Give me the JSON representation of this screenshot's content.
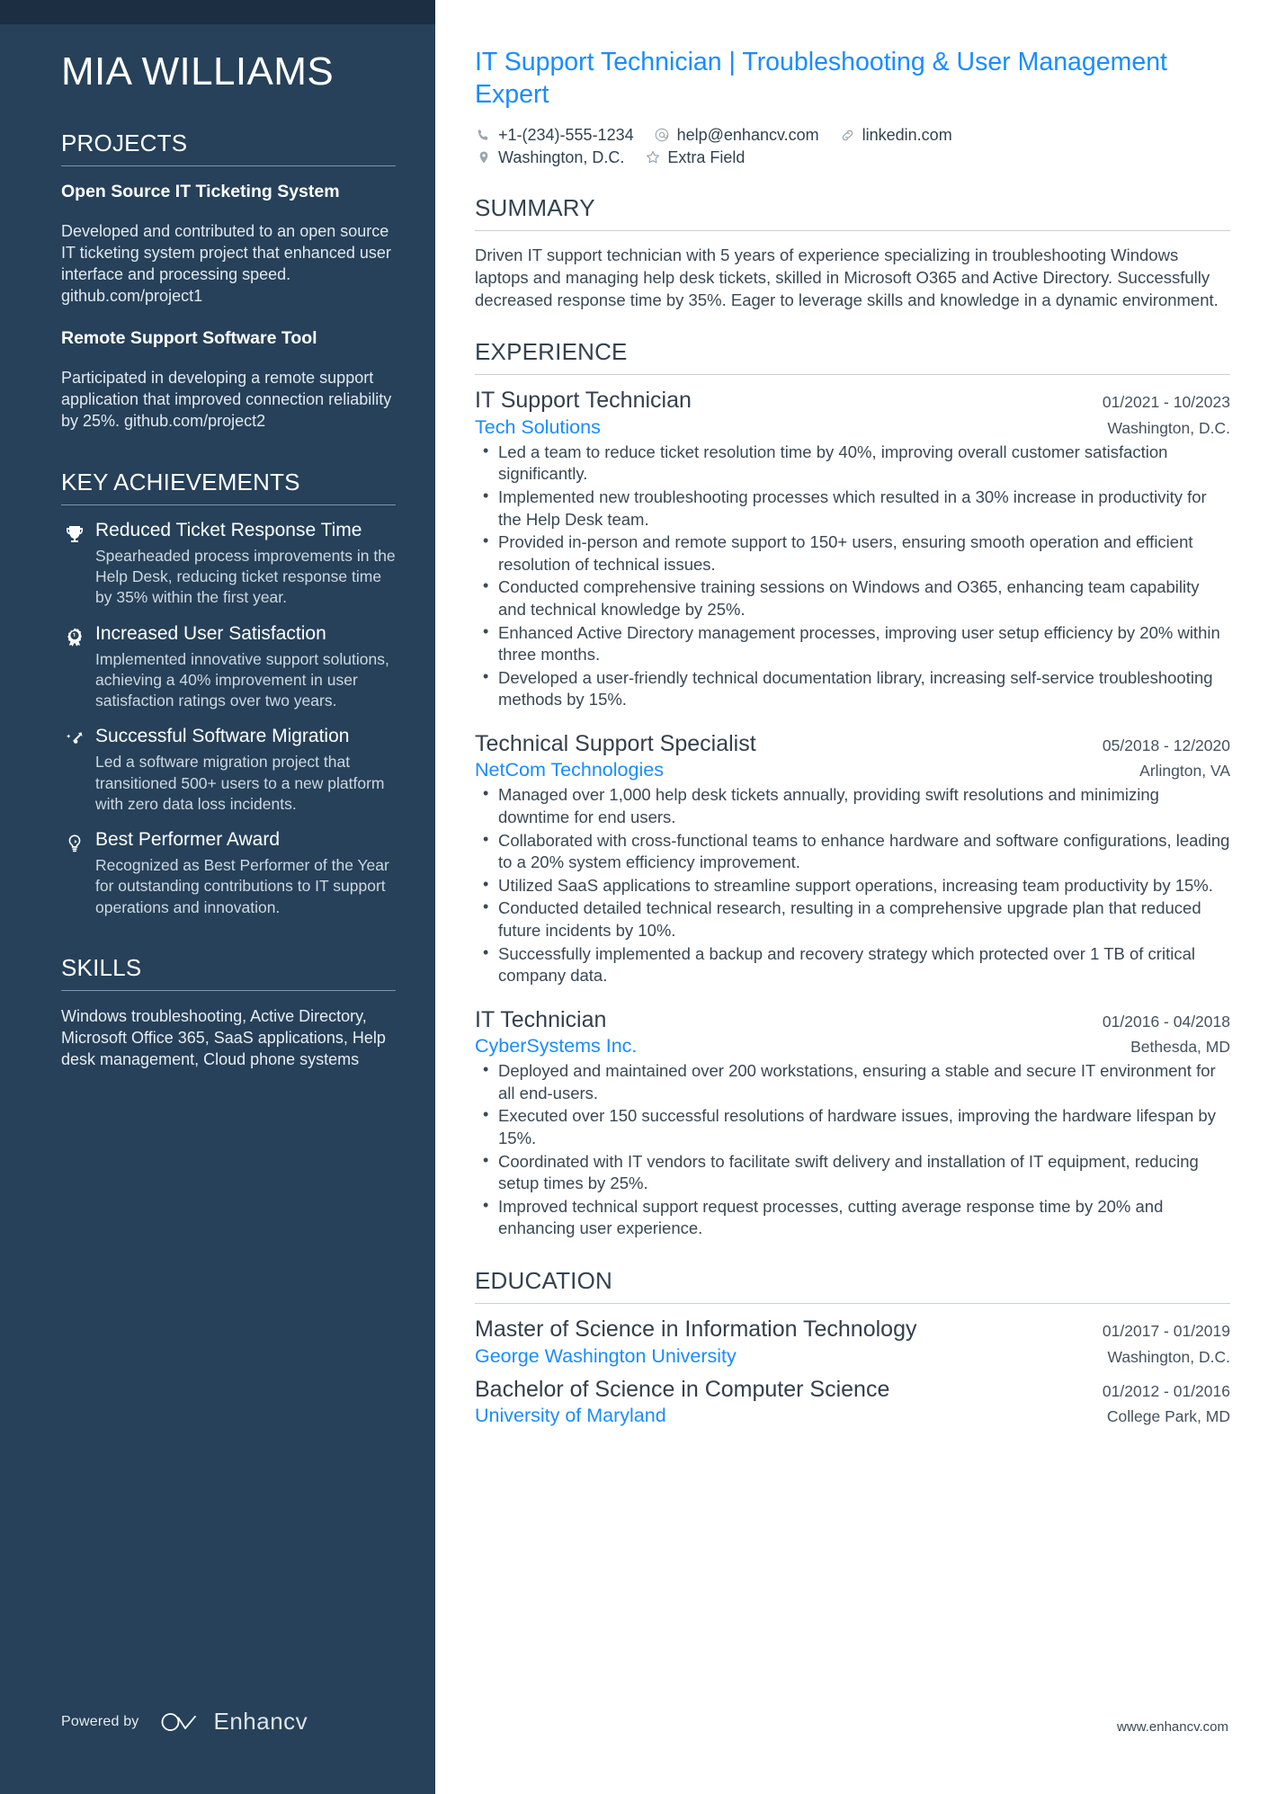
{
  "sidebar": {
    "name": "MIA WILLIAMS",
    "projects": {
      "title": "PROJECTS",
      "items": [
        {
          "name": "Open Source IT Ticketing System",
          "description": "Developed and contributed to an open source IT ticketing system project that enhanced user interface and processing speed. github.com/project1"
        },
        {
          "name": "Remote Support Software Tool",
          "description": "Participated in developing a remote support application that improved connection reliability by 25%. github.com/project2"
        }
      ]
    },
    "achievements": {
      "title": "KEY ACHIEVEMENTS",
      "items": [
        {
          "icon": "trophy-icon",
          "title": "Reduced Ticket Response Time",
          "description": "Spearheaded process improvements in the Help Desk, reducing ticket response time by 35% within the first year."
        },
        {
          "icon": "award-ribbon-icon",
          "title": "Increased User Satisfaction",
          "description": "Implemented innovative support solutions, achieving a 40% improvement in user satisfaction ratings over two years."
        },
        {
          "icon": "growth-arrow-icon",
          "title": "Successful Software Migration",
          "description": "Led a software migration project that transitioned 500+ users to a new platform with zero data loss incidents."
        },
        {
          "icon": "lightbulb-icon",
          "title": "Best Performer Award",
          "description": "Recognized as Best Performer of the Year for outstanding contributions to IT support operations and innovation."
        }
      ]
    },
    "skills": {
      "title": "SKILLS",
      "text": "Windows troubleshooting, Active Directory, Microsoft Office 365, SaaS applications, Help desk management, Cloud phone systems"
    },
    "footer": {
      "powered_by": "Powered by",
      "brand": "Enhancv"
    }
  },
  "main": {
    "headline": "IT Support Technician | Troubleshooting & User Management Expert",
    "contacts_row1": [
      {
        "icon": "phone-icon",
        "text": "+1-(234)-555-1234"
      },
      {
        "icon": "at-email-icon",
        "text": "help@enhancv.com"
      },
      {
        "icon": "link-icon",
        "text": "linkedin.com"
      }
    ],
    "contacts_row2": [
      {
        "icon": "location-pin-icon",
        "text": "Washington, D.C."
      },
      {
        "icon": "star-icon",
        "text": "Extra Field"
      }
    ],
    "summary": {
      "title": "SUMMARY",
      "text": "Driven IT support technician with 5 years of experience specializing in troubleshooting Windows laptops and managing help desk tickets, skilled in Microsoft O365 and Active Directory. Successfully decreased response time by 35%. Eager to leverage skills and knowledge in a dynamic environment."
    },
    "experience": {
      "title": "EXPERIENCE",
      "items": [
        {
          "title": "IT Support Technician",
          "date": "01/2021 - 10/2023",
          "org": "Tech Solutions",
          "location": "Washington, D.C.",
          "bullets": [
            "Led a team to reduce ticket resolution time by 40%, improving overall customer satisfaction significantly.",
            "Implemented new troubleshooting processes which resulted in a 30% increase in productivity for the Help Desk team.",
            "Provided in-person and remote support to 150+ users, ensuring smooth operation and efficient resolution of technical issues.",
            "Conducted comprehensive training sessions on Windows and O365, enhancing team capability and technical knowledge by 25%.",
            "Enhanced Active Directory management processes, improving user setup efficiency by 20% within three months.",
            "Developed a user-friendly technical documentation library, increasing self-service troubleshooting methods by 15%."
          ]
        },
        {
          "title": "Technical Support Specialist",
          "date": "05/2018 - 12/2020",
          "org": "NetCom Technologies",
          "location": "Arlington, VA",
          "bullets": [
            "Managed over 1,000 help desk tickets annually, providing swift resolutions and minimizing downtime for end users.",
            "Collaborated with cross-functional teams to enhance hardware and software configurations, leading to a 20% system efficiency improvement.",
            "Utilized SaaS applications to streamline support operations, increasing team productivity by 15%.",
            "Conducted detailed technical research, resulting in a comprehensive upgrade plan that reduced future incidents by 10%.",
            "Successfully implemented a backup and recovery strategy which protected over 1 TB of critical company data."
          ]
        },
        {
          "title": "IT Technician",
          "date": "01/2016 - 04/2018",
          "org": "CyberSystems Inc.",
          "location": "Bethesda, MD",
          "bullets": [
            "Deployed and maintained over 200 workstations, ensuring a stable and secure IT environment for all end-users.",
            "Executed over 150 successful resolutions of hardware issues, improving the hardware lifespan by 15%.",
            "Coordinated with IT vendors to facilitate swift delivery and installation of IT equipment, reducing setup times by 25%.",
            "Improved technical support request processes, cutting average response time by 20% and enhancing user experience."
          ]
        }
      ]
    },
    "education": {
      "title": "EDUCATION",
      "items": [
        {
          "title": "Master of Science in Information Technology",
          "date": "01/2017 - 01/2019",
          "org": "George Washington University",
          "location": "Washington, D.C."
        },
        {
          "title": "Bachelor of Science in Computer Science",
          "date": "01/2012 - 01/2016",
          "org": "University of Maryland",
          "location": "College Park, MD"
        }
      ]
    },
    "site_url": "www.enhancv.com"
  },
  "colors": {
    "sidebar_bg": "#264159",
    "sidebar_top": "#1b2e42",
    "accent_blue": "#1a8cff",
    "text_dark": "#33424f"
  }
}
